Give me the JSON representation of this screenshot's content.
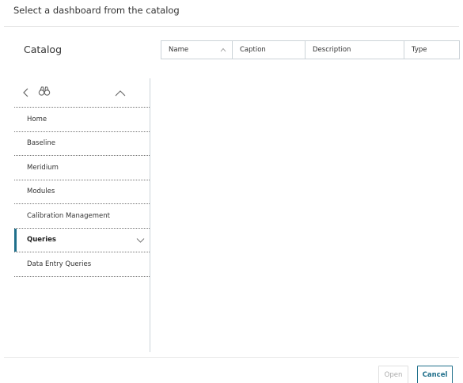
{
  "dialog": {
    "title": "Select a dashboard from the catalog"
  },
  "catalog": {
    "heading": "Catalog",
    "toolbar": {
      "back_icon": "chevron-left-icon",
      "search_icon": "binoculars-icon",
      "collapse_icon": "chevron-up-icon"
    },
    "items": [
      {
        "label": "Home"
      },
      {
        "label": "Baseline"
      },
      {
        "label": "Meridium"
      },
      {
        "label": "Modules"
      },
      {
        "label": "Calibration Management"
      },
      {
        "label": "Queries",
        "active": true,
        "expandable": true
      },
      {
        "label": "Data Entry Queries"
      }
    ]
  },
  "table": {
    "columns": [
      {
        "label": "Name",
        "sortable": true
      },
      {
        "label": "Caption"
      },
      {
        "label": "Description"
      },
      {
        "label": "Type"
      }
    ],
    "rows": []
  },
  "footer": {
    "open_label": "Open",
    "cancel_label": "Cancel"
  },
  "colors": {
    "accent": "#1f6f8b",
    "border": "#ccd3d8"
  }
}
